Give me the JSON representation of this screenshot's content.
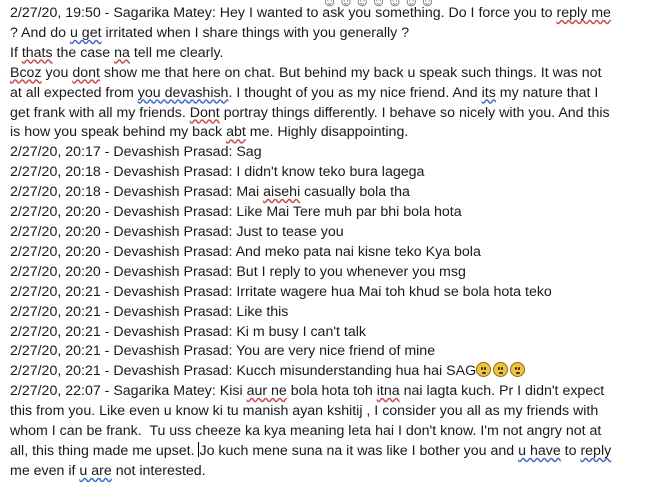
{
  "top_cut": "☺☺☺☺☺☺☺",
  "msg1": {
    "p1a": "2/27/20, 19:50 - Sagarika Matey: Hey I wanted to ask you something. Do I force you to ",
    "p1b": "reply me",
    "p1c": "\n? And do ",
    "p1d": "u get",
    "p1e": " irritated when I share things with you generally ?\nIf ",
    "p1f": "thats",
    "p1g": " the case ",
    "p1h": "na",
    "p1i": " tell me clearly.\n",
    "p1j": "Bcoz",
    "p1k": " you ",
    "p1l": "dont",
    "p1m": " show me that here on chat. But behind my back u speak such things. It was not\nat all expected from ",
    "p1n": "you devashish",
    "p1o": ". I thought of you as my nice friend. And ",
    "p1p": "its",
    "p1q": " my nature that I\nget frank with all my friends. ",
    "p1r": "Dont",
    "p1s": " portray things differently. I behave so nicely with you. And this\nis how you speak behind my back ",
    "p1t": "abt",
    "p1u": " me. Highly disappointing."
  },
  "lines": [
    "2/27/20, 20:17 - Devashish Prasad: Sag",
    "2/27/20, 20:18 - Devashish Prasad: I didn't know teko bura lagega"
  ],
  "line3a": "2/27/20, 20:18 - Devashish Prasad: Mai ",
  "line3b": "aisehi",
  "line3c": " casually bola tha",
  "lines2": [
    "2/27/20, 20:20 - Devashish Prasad: Like Mai Tere muh par bhi bola hota",
    "2/27/20, 20:20 - Devashish Prasad: Just to tease you",
    "2/27/20, 20:20 - Devashish Prasad: And meko pata nai kisne teko Kya bola",
    "2/27/20, 20:20 - Devashish Prasad: But I reply to you whenever you msg",
    "2/27/20, 20:21 - Devashish Prasad: Irritate wagere hua Mai toh khud se bola hota teko",
    "2/27/20, 20:21 - Devashish Prasad: Like this",
    "2/27/20, 20:21 - Devashish Prasad: Ki m busy I can't talk",
    "2/27/20, 20:21 - Devashish Prasad: You are very nice friend of mine"
  ],
  "line_emoji": "2/27/20, 20:21 - Devashish Prasad: Kucch misunderstanding hua hai SAG",
  "last": {
    "a": "2/27/20, 22:07 - Sagarika Matey: Kisi ",
    "b": "aur ne",
    "c": " bola hota toh ",
    "d": "itna",
    "e": " nai lagta kuch. Pr I didn't expect\nthis from you. Like even u know ki tu manish ayan kshitij , I consider you all as my friends with\nwhom I can be frank.  Tu uss cheeze ka kya meaning leta hai I don't know. I'm not angry not at\nall, this thing made me upset. ",
    "f": "Jo kuch mene suna na it was like I bother you and ",
    "g": "u have",
    "h": " to ",
    "i": "reply",
    "j": "\nme even if ",
    "k": "u are",
    "l": " not interested."
  }
}
